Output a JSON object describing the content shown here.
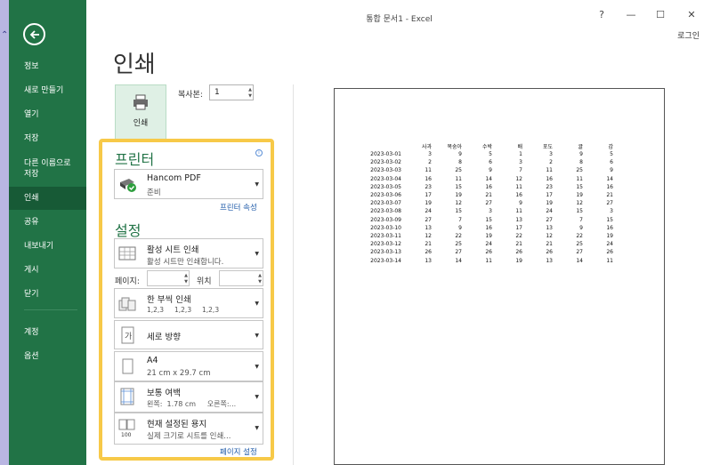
{
  "window": {
    "title": "통합 문서1 - Excel",
    "help": "?",
    "minimize": "—",
    "maximize": "☐",
    "close": "✕",
    "login": "로그인"
  },
  "sidebar": {
    "items": [
      {
        "label": "정보"
      },
      {
        "label": "새로 만들기"
      },
      {
        "label": "열기"
      },
      {
        "label": "저장"
      },
      {
        "label": "다른 이름으로 저장"
      },
      {
        "label": "인쇄"
      },
      {
        "label": "공유"
      },
      {
        "label": "내보내기"
      },
      {
        "label": "게시"
      },
      {
        "label": "닫기"
      },
      {
        "label": "계정"
      },
      {
        "label": "옵션"
      }
    ]
  },
  "page_title": "인쇄",
  "print": {
    "button_label": "인쇄",
    "copies_label": "복사본:",
    "copies_value": "1"
  },
  "printer": {
    "section_title": "프린터",
    "name": "Hancom PDF",
    "status": "준비",
    "properties_link": "프린터 속성"
  },
  "settings": {
    "section_title": "설정",
    "what": {
      "title": "활성 시트 인쇄",
      "desc": "활성 시트만 인쇄합니다."
    },
    "pages_label": "페이지:",
    "to_label": "위치",
    "sides": {
      "title": "한 부씩 인쇄",
      "desc": "1,2,3     1,2,3     1,2,3"
    },
    "orientation": {
      "title": "세로 방향"
    },
    "paper": {
      "title": "A4",
      "desc": "21 cm x 29.7 cm"
    },
    "margins": {
      "title": "보통 여백",
      "desc": "왼쪽:  1.78 cm     오른쪽:..."
    },
    "scaling": {
      "title": "현재 설정된 용지",
      "desc": "실제 크기로 시트를 인쇄..."
    },
    "page_setup_link": "페이지 설정"
  },
  "preview": {
    "headers": [
      "",
      "사과",
      "복숭아",
      "수박",
      "배",
      "포도",
      "귤",
      "감"
    ],
    "rows": [
      [
        "2023-03-01",
        "3",
        "9",
        "5",
        "1",
        "3",
        "9",
        "5"
      ],
      [
        "2023-03-02",
        "2",
        "8",
        "6",
        "3",
        "2",
        "8",
        "6"
      ],
      [
        "2023-03-03",
        "11",
        "25",
        "9",
        "7",
        "11",
        "25",
        "9"
      ],
      [
        "2023-03-04",
        "16",
        "11",
        "14",
        "12",
        "16",
        "11",
        "14"
      ],
      [
        "2023-03-05",
        "23",
        "15",
        "16",
        "11",
        "23",
        "15",
        "16"
      ],
      [
        "2023-03-06",
        "17",
        "19",
        "21",
        "16",
        "17",
        "19",
        "21"
      ],
      [
        "2023-03-07",
        "19",
        "12",
        "27",
        "9",
        "19",
        "12",
        "27"
      ],
      [
        "2023-03-08",
        "24",
        "15",
        "3",
        "11",
        "24",
        "15",
        "3"
      ],
      [
        "2023-03-09",
        "27",
        "7",
        "15",
        "13",
        "27",
        "7",
        "15"
      ],
      [
        "2023-03-10",
        "13",
        "9",
        "16",
        "17",
        "13",
        "9",
        "16"
      ],
      [
        "2023-03-11",
        "12",
        "22",
        "19",
        "22",
        "12",
        "22",
        "19"
      ],
      [
        "2023-03-12",
        "21",
        "25",
        "24",
        "21",
        "21",
        "25",
        "24"
      ],
      [
        "2023-03-13",
        "26",
        "27",
        "26",
        "26",
        "26",
        "27",
        "26"
      ],
      [
        "2023-03-14",
        "13",
        "14",
        "11",
        "19",
        "13",
        "14",
        "11"
      ]
    ]
  }
}
